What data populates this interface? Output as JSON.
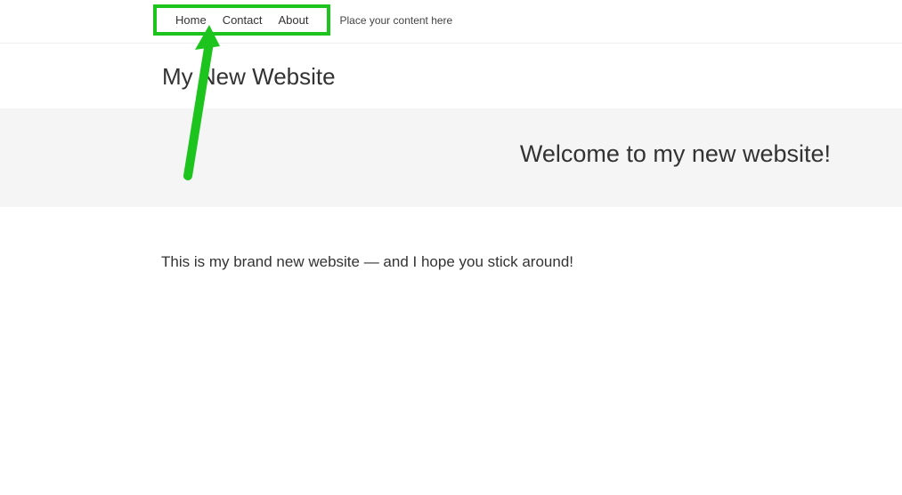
{
  "nav": {
    "items": [
      "Home",
      "Contact",
      "About"
    ],
    "hint": "Place your content here"
  },
  "site_title": "My New Website",
  "hero": {
    "heading": "Welcome to my new website!"
  },
  "body": {
    "intro": "This is my brand new website — and I hope you stick around!"
  },
  "annotation": {
    "color": "#1ec41e"
  }
}
